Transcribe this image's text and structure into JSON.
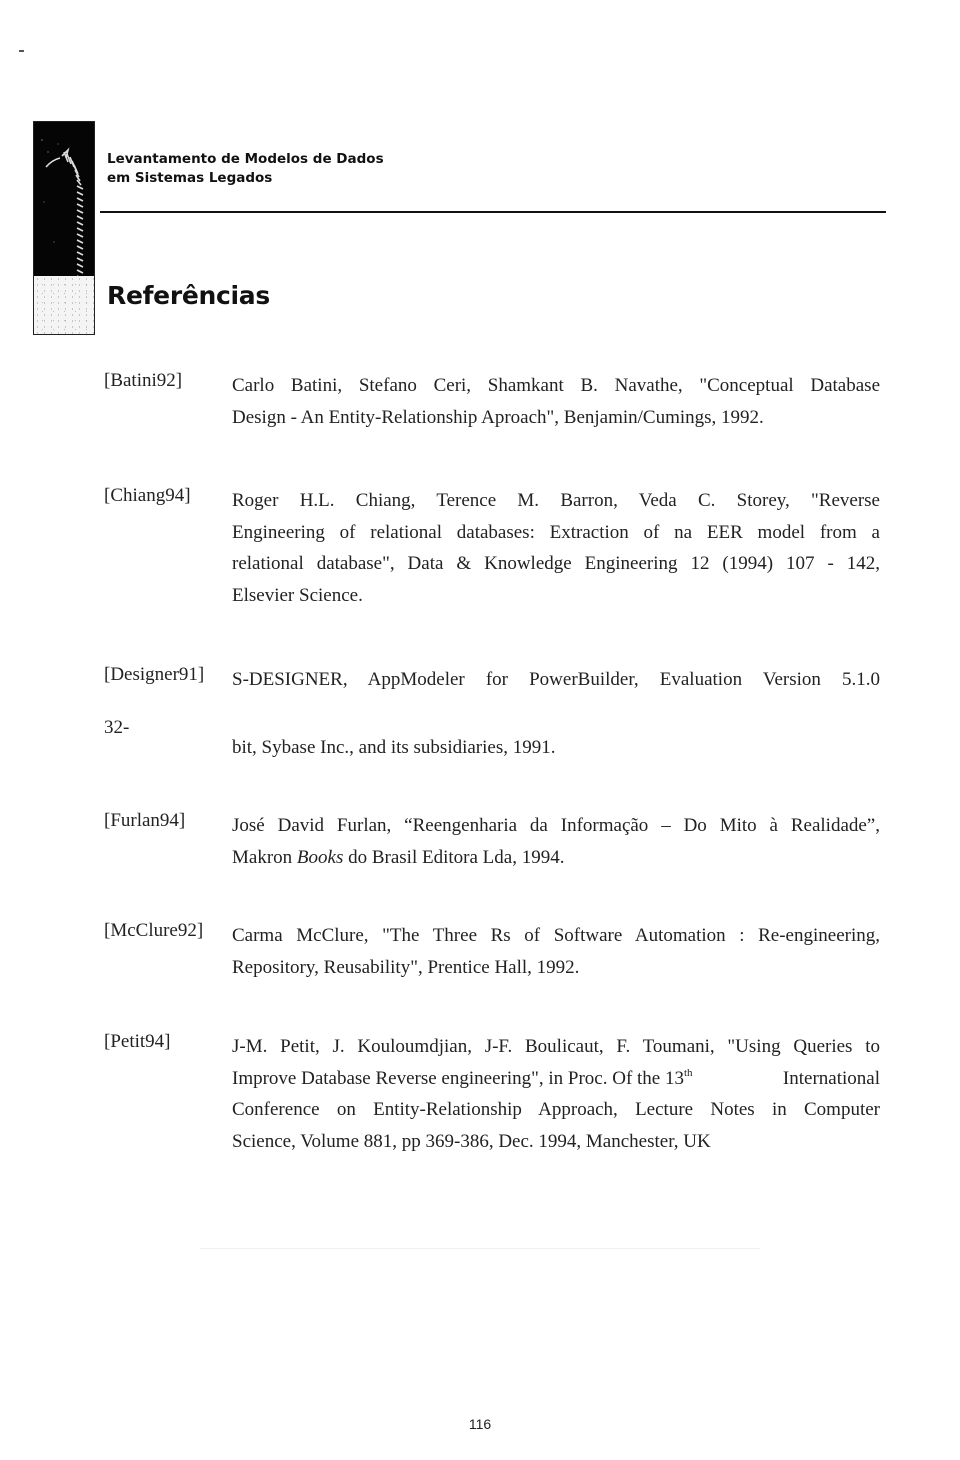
{
  "header": {
    "title_line1": "Levantamento de Modelos de Dados",
    "title_line2": "em Sistemas Legados",
    "logo_icon": "arrow-logo-icon"
  },
  "section": {
    "title": "Referências"
  },
  "references": [
    {
      "key": "[Batini92]",
      "lines": [
        "Carlo Batini, Stefano Ceri, Shamkant B. Navathe, \"Conceptual Database",
        "Design - An Entity-Relationship Aproach\", Benjamin/Cumings, 1992."
      ]
    },
    {
      "key": "[Chiang94]",
      "lines": [
        "Roger H.L. Chiang, Terence M. Barron, Veda C. Storey, \"Reverse",
        "Engineering of relational databases: Extraction of na EER model from a",
        "relational database\", Data & Knowledge Engineering 12 (1994) 107 - 142,",
        "Elsevier Science."
      ]
    },
    {
      "key": "[Designer91]",
      "lines": [
        "S-DESIGNER, AppModeler for PowerBuilder, Evaluation Version 5.1.0"
      ],
      "orphan": "32-",
      "continuation": "bit, Sybase Inc., and its subsidiaries, 1991."
    },
    {
      "key": "[Furlan94]",
      "lines": [
        "José David Furlan, “Reengenharia da Informação – Do Mito à Realidade”,"
      ],
      "line2_prefix": "Makron ",
      "line2_italic": "Books",
      "line2_suffix": " do Brasil Editora Lda, 1994."
    },
    {
      "key": "[McClure92]",
      "lines": [
        "Carma McClure, \"The Three Rs of Software Automation : Re-engineering,",
        "Repository, Reusability\", Prentice Hall, 1992."
      ]
    },
    {
      "key": "[Petit94]",
      "lines": [
        "J-M. Petit, J. Kouloumdjian, J-F. Boulicaut, F. Toumani, \"Using Queries to"
      ],
      "line2_prefix": "Improve Database Reverse engineering\", in Proc. Of the 13",
      "line2_sup": "th",
      "line2_suffix": " International",
      "line3": "Conference on Entity-Relationship Approach, Lecture Notes in Computer",
      "line4": "Science, Volume 881, pp 369-386, Dec. 1994, Manchester, UK"
    }
  ],
  "footer": {
    "page_number": "116"
  }
}
